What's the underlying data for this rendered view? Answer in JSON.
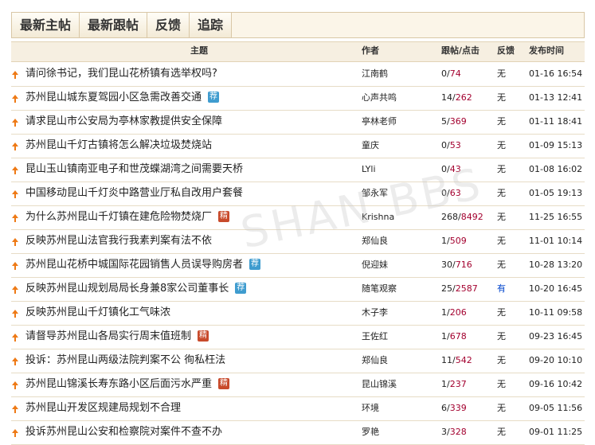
{
  "tabs": [
    {
      "label": "最新主帖"
    },
    {
      "label": "最新跟帖"
    },
    {
      "label": "反馈"
    },
    {
      "label": "追踪"
    }
  ],
  "columns": {
    "subject": "主题",
    "author": "作者",
    "replies_clicks": "跟帖/点击",
    "feedback": "反馈",
    "post_time": "发布时间"
  },
  "rows": [
    {
      "title": "请问徐书记，我们昆山花桥镇有选举权吗?",
      "badge": "",
      "author": "江南鹤",
      "replies": "0",
      "clicks": "74",
      "feedback": "无",
      "time": "01-16 16:54"
    },
    {
      "title": "苏州昆山城东夏驾园小区急需改善交通",
      "badge": "荐",
      "author": "心声共鸣",
      "replies": "14",
      "clicks": "262",
      "feedback": "无",
      "time": "01-13 12:41"
    },
    {
      "title": "请求昆山市公安局为亭林家教提供安全保障",
      "badge": "",
      "author": "亭林老师",
      "replies": "5",
      "clicks": "369",
      "feedback": "无",
      "time": "01-11 18:41"
    },
    {
      "title": "苏州昆山千灯古镇将怎么解决垃圾焚烧站",
      "badge": "",
      "author": "童庆",
      "replies": "0",
      "clicks": "53",
      "feedback": "无",
      "time": "01-09 15:13"
    },
    {
      "title": "昆山玉山镇南亚电子和世茂蝶湖湾之间需要天桥",
      "badge": "",
      "author": "LYli",
      "replies": "0",
      "clicks": "43",
      "feedback": "无",
      "time": "01-08 16:02"
    },
    {
      "title": "中国移动昆山千灯炎中路营业厅私自改用户套餐",
      "badge": "",
      "author": "邹永军",
      "replies": "0",
      "clicks": "63",
      "feedback": "无",
      "time": "01-05 19:13"
    },
    {
      "title": "为什么苏州昆山千灯镇在建危险物焚烧厂",
      "badge": "精",
      "author": "Krishna",
      "replies": "268",
      "clicks": "8492",
      "feedback": "无",
      "time": "11-25 16:55"
    },
    {
      "title": "反映苏州昆山法官我行我素判案有法不依",
      "badge": "",
      "author": "郑仙良",
      "replies": "1",
      "clicks": "509",
      "feedback": "无",
      "time": "11-01 10:14"
    },
    {
      "title": "苏州昆山花桥中城国际花园销售人员误导购房者",
      "badge": "荐",
      "author": "倪迎妹",
      "replies": "30",
      "clicks": "716",
      "feedback": "无",
      "time": "10-28 13:20"
    },
    {
      "title": "反映苏州昆山规划局局长身兼8家公司董事长",
      "badge": "荐",
      "author": "随笔观察",
      "replies": "25",
      "clicks": "2587",
      "feedback": "有",
      "time": "10-20 16:45"
    },
    {
      "title": "反映苏州昆山千灯镇化工气味浓",
      "badge": "",
      "author": "木子李",
      "replies": "1",
      "clicks": "206",
      "feedback": "无",
      "time": "10-11 09:58"
    },
    {
      "title": "请督导苏州昆山各局实行周末值班制",
      "badge": "精red",
      "author": "王佐红",
      "replies": "1",
      "clicks": "678",
      "feedback": "无",
      "time": "09-23 16:45"
    },
    {
      "title": "投诉：苏州昆山两级法院判案不公 徇私枉法",
      "badge": "",
      "author": "郑仙良",
      "replies": "11",
      "clicks": "542",
      "feedback": "无",
      "time": "09-20 10:10"
    },
    {
      "title": "苏州昆山锦溪长寿东路小区后面污水严重",
      "badge": "精",
      "author": "昆山锦溪",
      "replies": "1",
      "clicks": "237",
      "feedback": "无",
      "time": "09-16 10:42"
    },
    {
      "title": "苏州昆山开发区规建局规划不合理",
      "badge": "",
      "author": "环境",
      "replies": "6",
      "clicks": "339",
      "feedback": "无",
      "time": "09-05 11:56"
    },
    {
      "title": "投诉苏州昆山公安和检察院对案件不查不办",
      "badge": "",
      "author": "罗艳",
      "replies": "3",
      "clicks": "328",
      "feedback": "无",
      "time": "09-01 11:25"
    }
  ],
  "colors": {
    "accent_orange": "#ee7a16",
    "click_red": "#a3002e",
    "badge_blue": "#3f9ccf",
    "badge_red": "#c84a2b"
  },
  "icons": {
    "row_marker": "up-arrow-icon"
  }
}
